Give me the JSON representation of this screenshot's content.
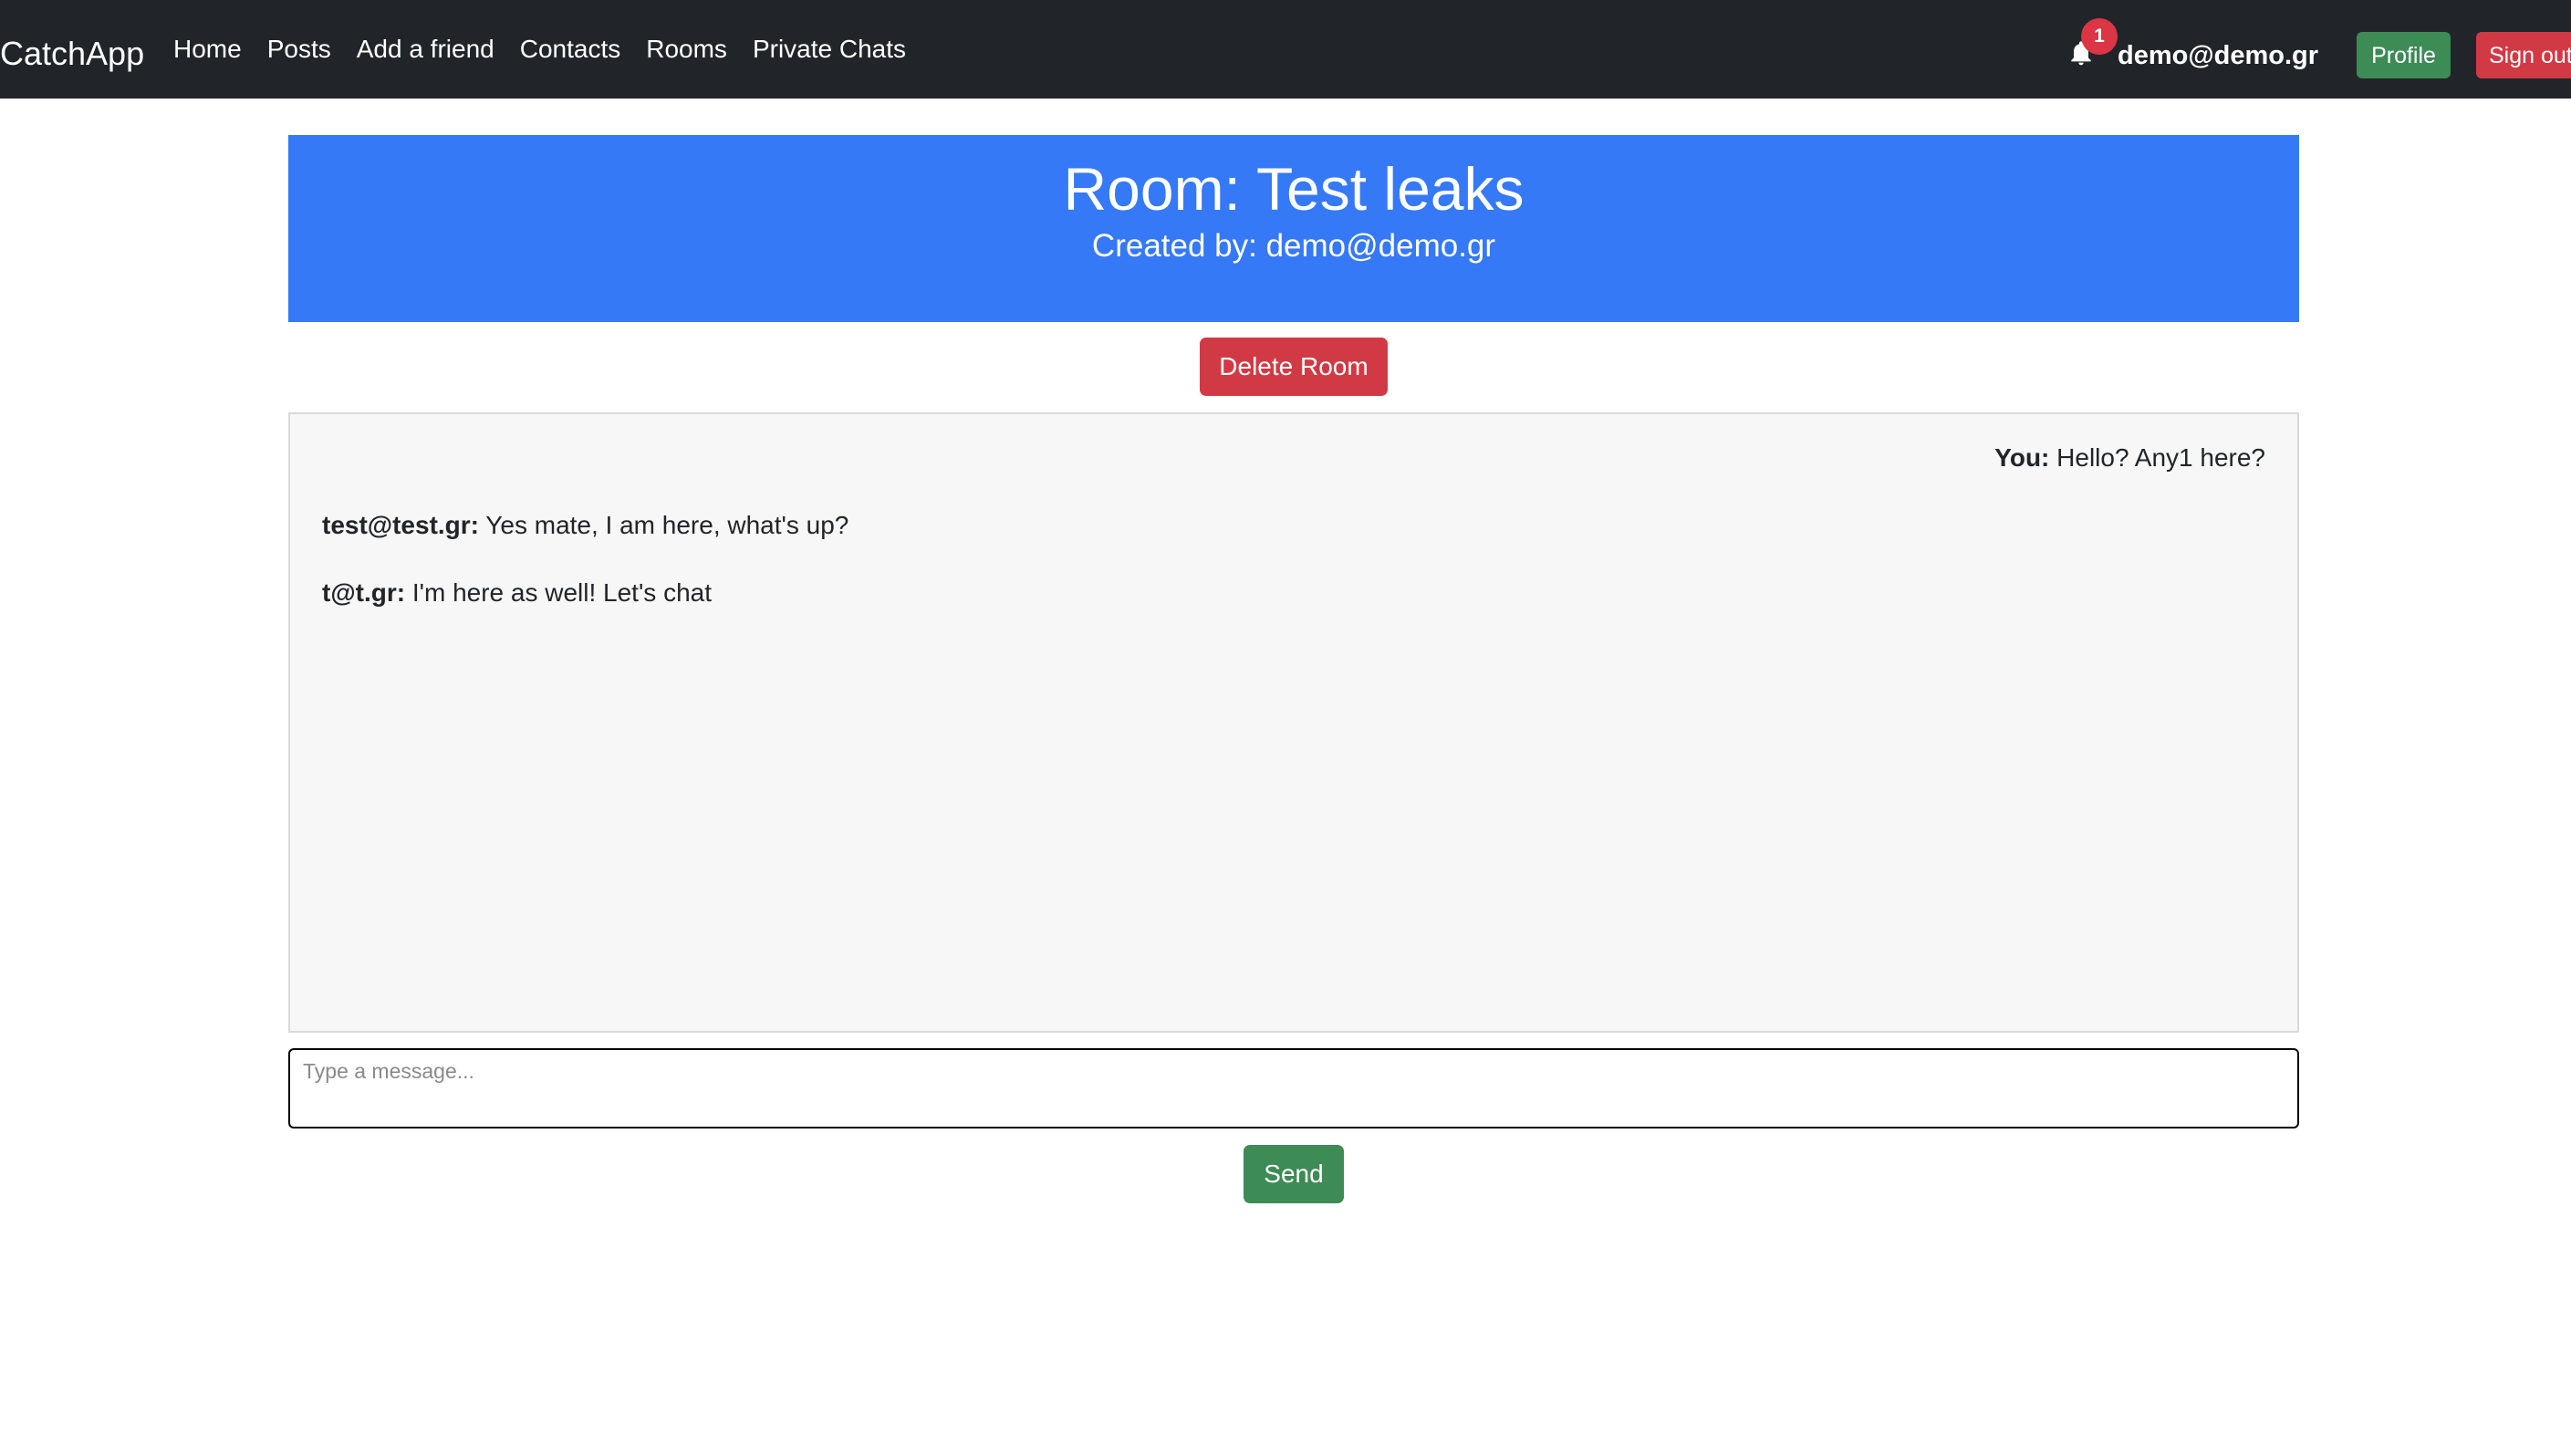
{
  "navbar": {
    "brand": "CatchApp",
    "links": [
      {
        "label": "Home"
      },
      {
        "label": "Posts"
      },
      {
        "label": "Add a friend"
      },
      {
        "label": "Contacts"
      },
      {
        "label": "Rooms"
      },
      {
        "label": "Private Chats"
      }
    ],
    "notifications": {
      "icon": "bell-icon",
      "count": "1"
    },
    "user_email": "demo@demo.gr",
    "profile_label": "Profile",
    "signout_label": "Sign out"
  },
  "room": {
    "title": "Room: Test leaks",
    "created_by": "Created by: demo@demo.gr",
    "delete_label": "Delete Room"
  },
  "messages": [
    {
      "sender": "You:",
      "text": "Hello? Any1 here?",
      "mine": true
    },
    {
      "sender": "test@test.gr:",
      "text": "Yes mate, I am here, what's up?",
      "mine": false
    },
    {
      "sender": "t@t.gr:",
      "text": "I'm here as well! Let's chat",
      "mine": false
    }
  ],
  "composer": {
    "placeholder": "Type a message...",
    "value": "",
    "send_label": "Send"
  },
  "colors": {
    "navbar_bg": "#212529",
    "header_bg": "#3579f6",
    "danger": "#d13a44",
    "success": "#3d8b55",
    "chat_bg": "#f7f7f7"
  }
}
